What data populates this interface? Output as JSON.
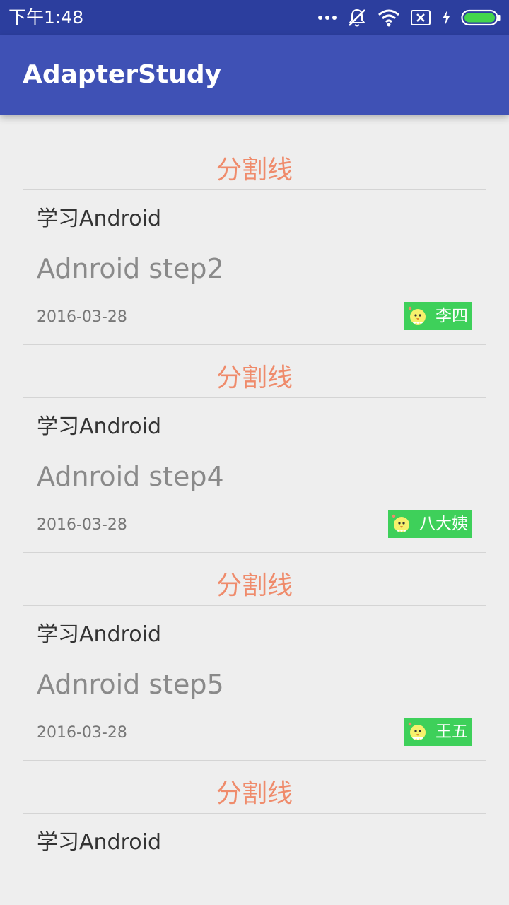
{
  "status_bar": {
    "time": "下午1:48",
    "icons": [
      "more-dots-icon",
      "mute-bell-icon",
      "wifi-icon",
      "no-sim-icon",
      "charging-icon",
      "battery-icon"
    ]
  },
  "app_bar": {
    "title": "AdapterStudy"
  },
  "list": {
    "divider_label": "分割线",
    "items": [
      {
        "title": "学习Android",
        "step": "Adnroid step2",
        "date": "2016-03-28",
        "author": "李四"
      },
      {
        "title": "学习Android",
        "step": "Adnroid step4",
        "date": "2016-03-28",
        "author": "八大姨"
      },
      {
        "title": "学习Android",
        "step": "Adnroid step5",
        "date": "2016-03-28",
        "author": "王五"
      },
      {
        "title": "学习Android"
      }
    ]
  },
  "colors": {
    "status_bar": "#2c3e9e",
    "app_bar": "#3f51b5",
    "divider_text": "#ef8b6b",
    "badge": "#3ed05a",
    "background": "#eeeeee"
  }
}
